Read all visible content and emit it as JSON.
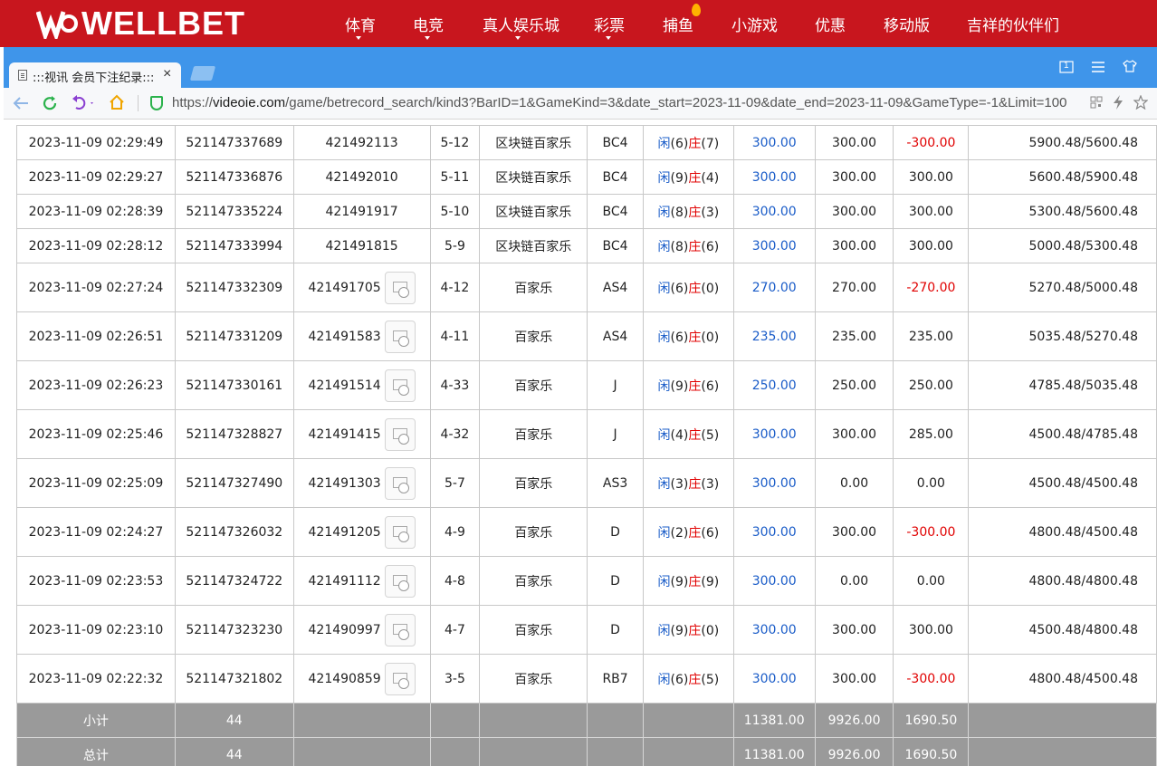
{
  "site": {
    "logo_text": "WELLBET",
    "nav": [
      {
        "label": "体育",
        "has_dropdown": true
      },
      {
        "label": "电竞",
        "has_dropdown": true
      },
      {
        "label": "真人娱乐城",
        "has_dropdown": true
      },
      {
        "label": "彩票",
        "has_dropdown": true
      },
      {
        "label": "捕鱼",
        "has_dropdown": false,
        "hot": true
      },
      {
        "label": "小游戏",
        "has_dropdown": false
      },
      {
        "label": "优惠",
        "has_dropdown": false
      },
      {
        "label": "移动版",
        "has_dropdown": false
      },
      {
        "label": "吉祥的伙伴们",
        "has_dropdown": false
      }
    ]
  },
  "browser": {
    "tab_title": ":::视讯 会员下注纪录:::",
    "tab_close": "×",
    "url_prefix": "https://",
    "url_host": "videoie.com",
    "url_path": "/game/betrecord_search/kind3?BarID=1&GameKind=3&date_start=2023-11-09&date_end=2023-11-09&GameType=-1&Limit=100",
    "toolbar_page_badge": "1"
  },
  "table": {
    "rows": [
      {
        "time": "2023-11-09 02:29:49",
        "bet_id": "521147337689",
        "round_id": "421492113",
        "has_video": false,
        "shoe": "5-12",
        "game": "区块链百家乐",
        "table": "BC4",
        "player": "闲",
        "player_pts": "(6)",
        "banker": "庄",
        "banker_pts": "(7)",
        "bet": "300.00",
        "valid": "300.00",
        "win": "-300.00",
        "balance": "5900.48/5600.48"
      },
      {
        "time": "2023-11-09 02:29:27",
        "bet_id": "521147336876",
        "round_id": "421492010",
        "has_video": false,
        "shoe": "5-11",
        "game": "区块链百家乐",
        "table": "BC4",
        "player": "闲",
        "player_pts": "(9)",
        "banker": "庄",
        "banker_pts": "(4)",
        "bet": "300.00",
        "valid": "300.00",
        "win": "300.00",
        "balance": "5600.48/5900.48"
      },
      {
        "time": "2023-11-09 02:28:39",
        "bet_id": "521147335224",
        "round_id": "421491917",
        "has_video": false,
        "shoe": "5-10",
        "game": "区块链百家乐",
        "table": "BC4",
        "player": "闲",
        "player_pts": "(8)",
        "banker": "庄",
        "banker_pts": "(3)",
        "bet": "300.00",
        "valid": "300.00",
        "win": "300.00",
        "balance": "5300.48/5600.48"
      },
      {
        "time": "2023-11-09 02:28:12",
        "bet_id": "521147333994",
        "round_id": "421491815",
        "has_video": false,
        "shoe": "5-9",
        "game": "区块链百家乐",
        "table": "BC4",
        "player": "闲",
        "player_pts": "(8)",
        "banker": "庄",
        "banker_pts": "(6)",
        "bet": "300.00",
        "valid": "300.00",
        "win": "300.00",
        "balance": "5000.48/5300.48"
      },
      {
        "time": "2023-11-09 02:27:24",
        "bet_id": "521147332309",
        "round_id": "421491705",
        "has_video": true,
        "shoe": "4-12",
        "game": "百家乐",
        "table": "AS4",
        "player": "闲",
        "player_pts": "(6)",
        "banker": "庄",
        "banker_pts": "(0)",
        "bet": "270.00",
        "valid": "270.00",
        "win": "-270.00",
        "balance": "5270.48/5000.48"
      },
      {
        "time": "2023-11-09 02:26:51",
        "bet_id": "521147331209",
        "round_id": "421491583",
        "has_video": true,
        "shoe": "4-11",
        "game": "百家乐",
        "table": "AS4",
        "player": "闲",
        "player_pts": "(6)",
        "banker": "庄",
        "banker_pts": "(0)",
        "bet": "235.00",
        "valid": "235.00",
        "win": "235.00",
        "balance": "5035.48/5270.48"
      },
      {
        "time": "2023-11-09 02:26:23",
        "bet_id": "521147330161",
        "round_id": "421491514",
        "has_video": true,
        "shoe": "4-33",
        "game": "百家乐",
        "table": "J",
        "player": "闲",
        "player_pts": "(9)",
        "banker": "庄",
        "banker_pts": "(6)",
        "bet": "250.00",
        "valid": "250.00",
        "win": "250.00",
        "balance": "4785.48/5035.48"
      },
      {
        "time": "2023-11-09 02:25:46",
        "bet_id": "521147328827",
        "round_id": "421491415",
        "has_video": true,
        "shoe": "4-32",
        "game": "百家乐",
        "table": "J",
        "player": "闲",
        "player_pts": "(4)",
        "banker": "庄",
        "banker_pts": "(5)",
        "bet": "300.00",
        "valid": "300.00",
        "win": "285.00",
        "balance": "4500.48/4785.48"
      },
      {
        "time": "2023-11-09 02:25:09",
        "bet_id": "521147327490",
        "round_id": "421491303",
        "has_video": true,
        "shoe": "5-7",
        "game": "百家乐",
        "table": "AS3",
        "player": "闲",
        "player_pts": "(3)",
        "banker": "庄",
        "banker_pts": "(3)",
        "bet": "300.00",
        "valid": "0.00",
        "win": "0.00",
        "balance": "4500.48/4500.48"
      },
      {
        "time": "2023-11-09 02:24:27",
        "bet_id": "521147326032",
        "round_id": "421491205",
        "has_video": true,
        "shoe": "4-9",
        "game": "百家乐",
        "table": "D",
        "player": "闲",
        "player_pts": "(2)",
        "banker": "庄",
        "banker_pts": "(6)",
        "bet": "300.00",
        "valid": "300.00",
        "win": "-300.00",
        "balance": "4800.48/4500.48"
      },
      {
        "time": "2023-11-09 02:23:53",
        "bet_id": "521147324722",
        "round_id": "421491112",
        "has_video": true,
        "shoe": "4-8",
        "game": "百家乐",
        "table": "D",
        "player": "闲",
        "player_pts": "(9)",
        "banker": "庄",
        "banker_pts": "(9)",
        "bet": "300.00",
        "valid": "0.00",
        "win": "0.00",
        "balance": "4800.48/4800.48"
      },
      {
        "time": "2023-11-09 02:23:10",
        "bet_id": "521147323230",
        "round_id": "421490997",
        "has_video": true,
        "shoe": "4-7",
        "game": "百家乐",
        "table": "D",
        "player": "闲",
        "player_pts": "(9)",
        "banker": "庄",
        "banker_pts": "(0)",
        "bet": "300.00",
        "valid": "300.00",
        "win": "300.00",
        "balance": "4500.48/4800.48"
      },
      {
        "time": "2023-11-09 02:22:32",
        "bet_id": "521147321802",
        "round_id": "421490859",
        "has_video": true,
        "shoe": "3-5",
        "game": "百家乐",
        "table": "RB7",
        "player": "闲",
        "player_pts": "(6)",
        "banker": "庄",
        "banker_pts": "(5)",
        "bet": "300.00",
        "valid": "300.00",
        "win": "-300.00",
        "balance": "4800.48/4500.48"
      }
    ],
    "subtotal": {
      "label": "小计",
      "count": "44",
      "bet": "11381.00",
      "valid": "9926.00",
      "win": "1690.50"
    },
    "total": {
      "label": "总计",
      "count": "44",
      "bet": "11381.00",
      "valid": "9926.00",
      "win": "1690.50"
    }
  },
  "colors": {
    "header_red": "#c8161e",
    "browser_blue": "#3f95ea",
    "player_blue": "#1a5cc8",
    "banker_red": "#e00000",
    "summary_gray": "#9a9a9a"
  }
}
